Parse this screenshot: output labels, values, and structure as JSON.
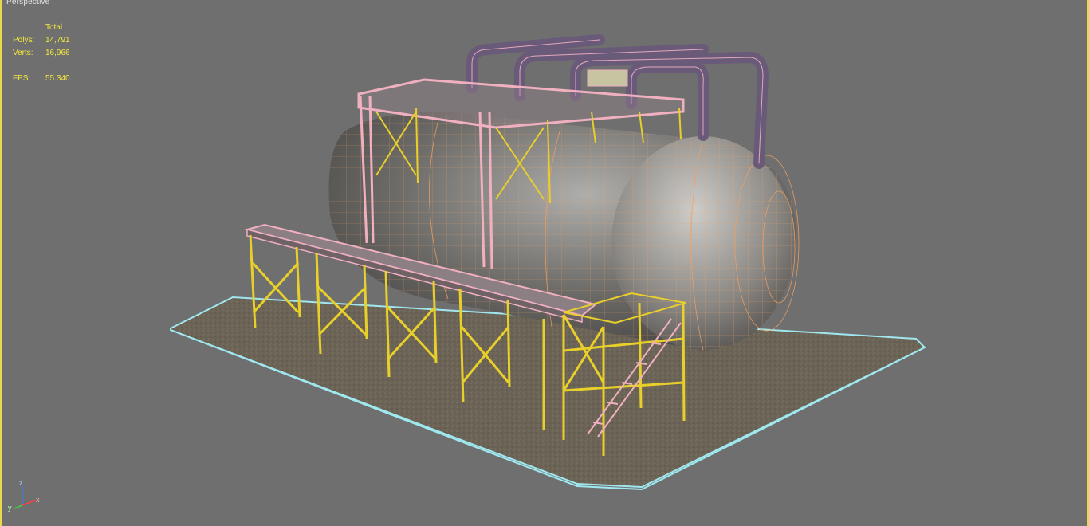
{
  "viewport": {
    "label": "Perspective",
    "stats": {
      "header": "Total",
      "polys_label": "Polys:",
      "polys_value": "14,791",
      "verts_label": "Verts:",
      "verts_value": "16,966",
      "fps_label": "FPS:",
      "fps_value": "55.340"
    },
    "axes": {
      "x": "x",
      "y": "y",
      "z": "z"
    }
  },
  "colors": {
    "viewport_bg": "#6f6f6f",
    "border_active": "#e8d84a",
    "stats_text": "#f2ea3c",
    "wire_frame": "#e8cf2a",
    "wire_pink": "#f0b0c0",
    "tank_wire": "#f0a060",
    "base_outline": "#a0e8f0"
  },
  "icons": [
    "axis-tripod-icon"
  ]
}
